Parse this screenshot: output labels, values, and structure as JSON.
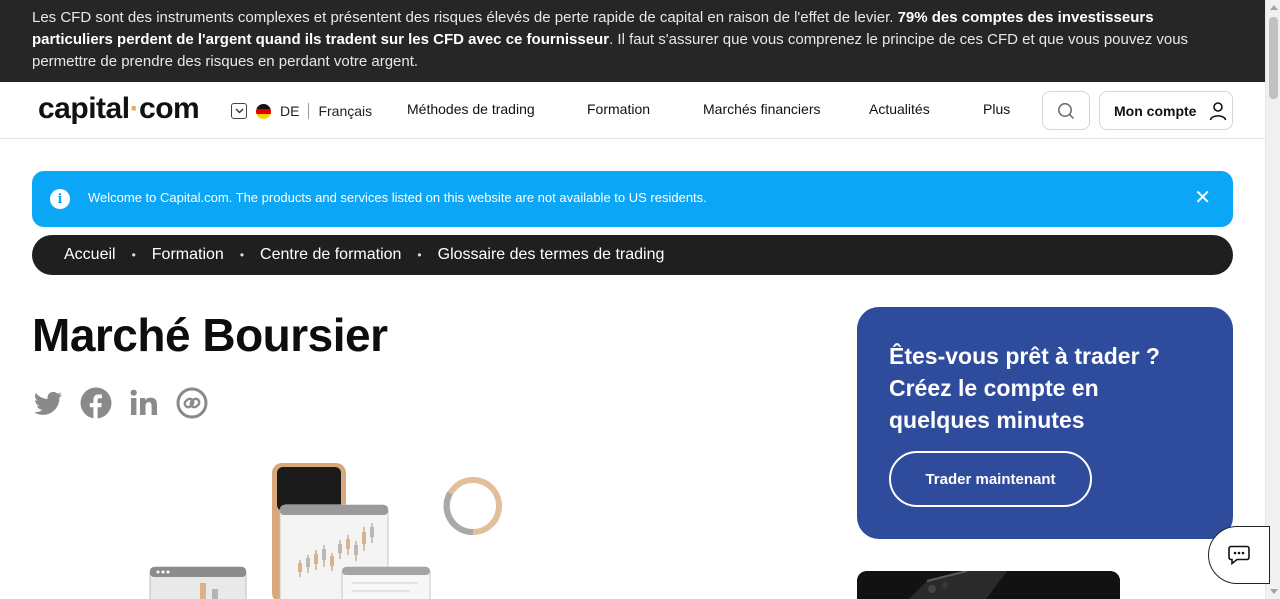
{
  "risk_banner": {
    "text_part1": "Les CFD sont des instruments complexes et présentent des risques élevés de perte rapide de capital en raison de l'effet de levier. ",
    "text_bold": "79% des comptes des investisseurs particuliers perdent de l'argent quand ils tradent sur les CFD avec ce fournisseur",
    "text_part2": ". Il faut s'assurer que vous comprenez le principe de ces CFD et que vous pouvez vous permettre de prendre des risques en perdant votre argent."
  },
  "header": {
    "logo_left": "capital",
    "logo_dot": "·",
    "logo_right": "com",
    "locale": {
      "country_code": "DE",
      "language": "Français",
      "flag_icon": "germany-flag-icon",
      "chevron_icon": "chevron-down-icon"
    },
    "nav": [
      {
        "label": "Méthodes de trading"
      },
      {
        "label": "Formation"
      },
      {
        "label": "Marchés financiers"
      },
      {
        "label": "Actualités"
      },
      {
        "label": "Plus"
      }
    ],
    "search_icon": "search-icon",
    "account_label": "Mon compte",
    "account_icon": "user-icon"
  },
  "info_banner": {
    "text": "Welcome to Capital.com. The products and services listed on this website are not available to US residents.",
    "icon": "info-icon",
    "info_glyph": "i",
    "close_glyph": "✕",
    "color": "#0ba6f5"
  },
  "breadcrumb": {
    "items": [
      "Accueil",
      "Formation",
      "Centre de formation",
      "Glossaire des termes de trading"
    ],
    "separator": "•"
  },
  "page": {
    "title": "Marché Boursier",
    "share_icons": [
      "twitter-icon",
      "facebook-icon",
      "linkedin-icon",
      "copy-link-icon"
    ]
  },
  "cta_card": {
    "title": "Êtes-vous prêt à trader ? Créez le compte en quelques minutes",
    "button_label": "Trader maintenant",
    "color": "#2f4b9b"
  },
  "chat": {
    "icon": "chat-icon"
  },
  "colors": {
    "accent": "#e5a86a",
    "dark": "#1f1f1f"
  }
}
